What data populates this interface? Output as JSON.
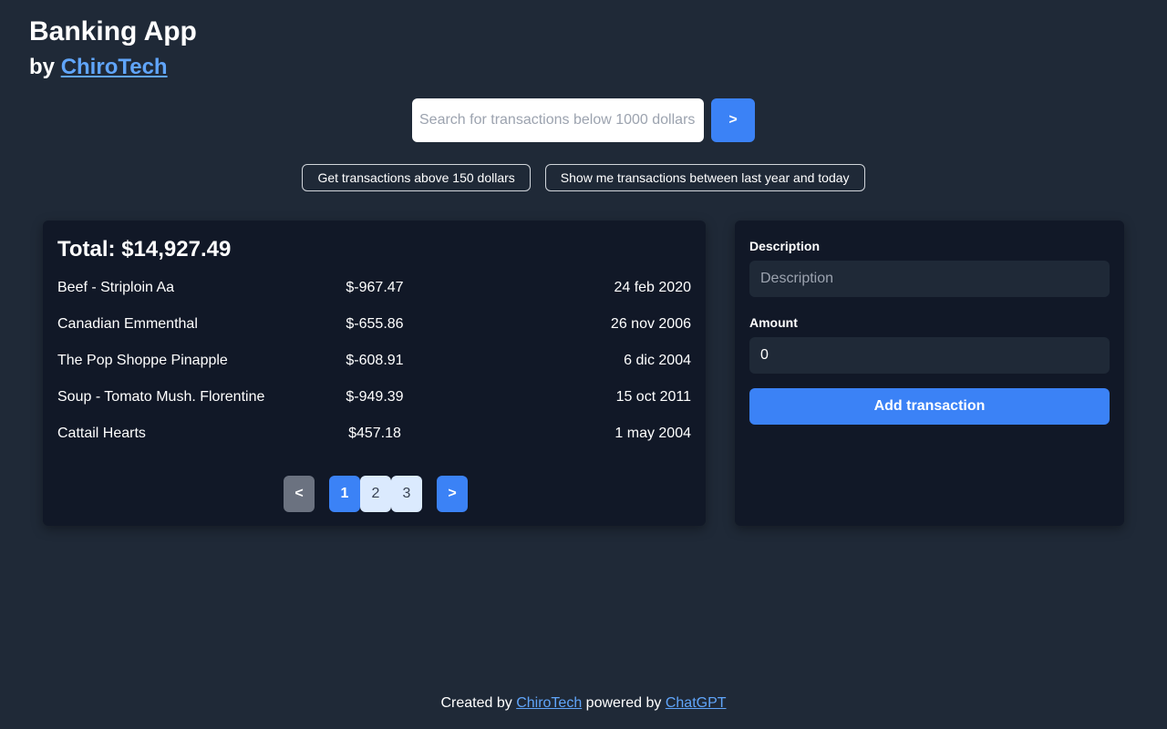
{
  "header": {
    "title": "Banking App",
    "by_prefix": "by",
    "by_link": "ChiroTech"
  },
  "search": {
    "placeholder": "Search for transactions below 1000 dollars",
    "submit_label": ">"
  },
  "suggestions": [
    "Get transactions above 150 dollars",
    "Show me transactions between last year and today"
  ],
  "transactions": {
    "total_label": "Total: $14,927.49",
    "rows": [
      {
        "description": "Beef - Striploin Aa",
        "amount": "$-967.47",
        "date": "24 feb 2020"
      },
      {
        "description": "Canadian Emmenthal",
        "amount": "$-655.86",
        "date": "26 nov 2006"
      },
      {
        "description": "The Pop Shoppe Pinapple",
        "amount": "$-608.91",
        "date": "6 dic 2004"
      },
      {
        "description": "Soup - Tomato Mush. Florentine",
        "amount": "$-949.39",
        "date": "15 oct 2011"
      },
      {
        "description": "Cattail Hearts",
        "amount": "$457.18",
        "date": "1 may 2004"
      }
    ],
    "pagination": {
      "prev": "<",
      "next": ">",
      "pages": [
        "1",
        "2",
        "3"
      ],
      "current": "1"
    }
  },
  "form": {
    "description_label": "Description",
    "description_placeholder": "Description",
    "amount_label": "Amount",
    "amount_value": "0",
    "submit_label": "Add transaction"
  },
  "footer": {
    "created_by": "Created by",
    "author_link": "ChiroTech",
    "powered_by": "powered by",
    "powered_link": "ChatGPT"
  },
  "colors": {
    "background": "#1f2937",
    "panel": "#111827",
    "accent": "#3b82f6",
    "link": "#60a5fa"
  }
}
